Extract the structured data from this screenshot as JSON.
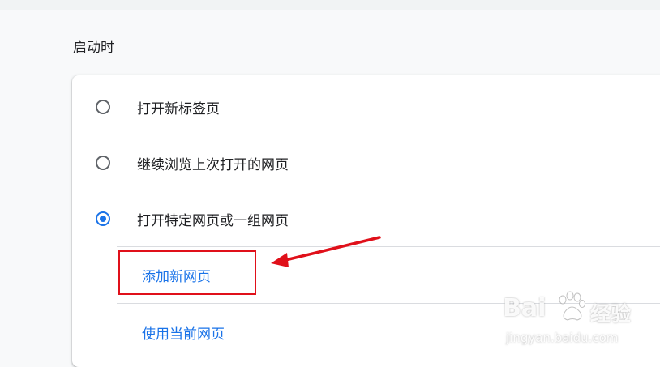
{
  "section": {
    "title": "启动时"
  },
  "startup_options": [
    {
      "label": "打开新标签页",
      "checked": false
    },
    {
      "label": "继续浏览上次打开的网页",
      "checked": false
    },
    {
      "label": "打开特定网页或一组网页",
      "checked": true
    }
  ],
  "pages_actions": {
    "add_new_page": "添加新网页",
    "use_current_pages": "使用当前网页"
  },
  "watermark": {
    "brand_part1": "Bai",
    "brand_part2": "经验",
    "url": "jingyan.baidu.com"
  },
  "colors": {
    "accent": "#1a73e8",
    "annotation": "#e0101a"
  }
}
